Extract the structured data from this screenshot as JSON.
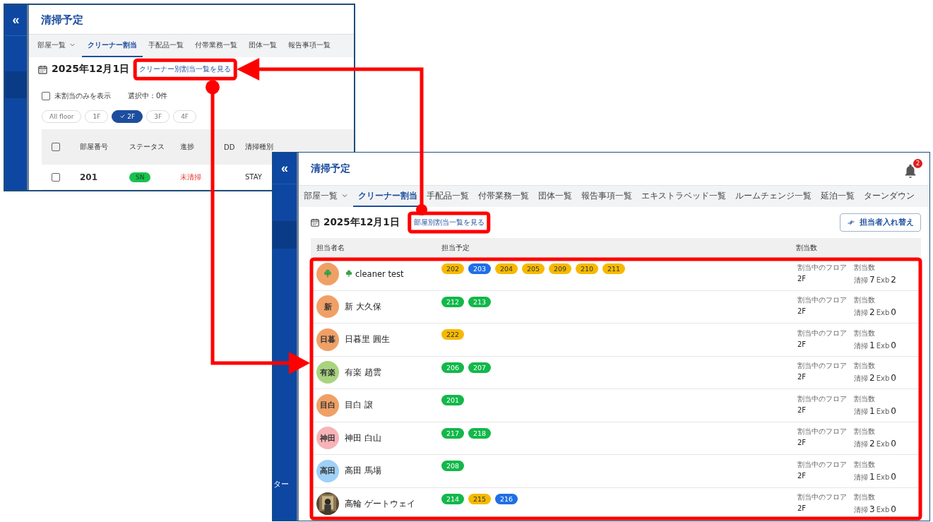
{
  "window_1": {
    "collapse": "«",
    "title": "清掃予定",
    "tabs": [
      {
        "label": "部屋一覧",
        "selected": false,
        "dropdown": true
      },
      {
        "label": "クリーナー割当",
        "selected": true,
        "dropdown": false
      },
      {
        "label": "手配品一覧",
        "selected": false,
        "dropdown": false
      },
      {
        "label": "付帯業務一覧",
        "selected": false,
        "dropdown": false
      },
      {
        "label": "団体一覧",
        "selected": false,
        "dropdown": false
      },
      {
        "label": "報告事項一覧",
        "selected": false,
        "dropdown": false
      }
    ],
    "date": "2025年12月1日",
    "link": "クリーナー別割当一覧を見る",
    "filter": {
      "label": "未割当のみを表示",
      "checked": false
    },
    "selection": "選択中：0件",
    "floors": [
      {
        "label": "All floor",
        "selected": false
      },
      {
        "label": "1F",
        "selected": false
      },
      {
        "label": "2F",
        "selected": true
      },
      {
        "label": "3F",
        "selected": false
      },
      {
        "label": "4F",
        "selected": false
      }
    ],
    "table": {
      "select_all_checked": false,
      "columns": [
        "部屋番号",
        "ステータス",
        "進捗",
        "DD",
        "清掃種別"
      ],
      "rows": [
        {
          "checked": false,
          "room": "201",
          "status": "SN",
          "progress": "未清掃",
          "type": "STAY"
        }
      ]
    }
  },
  "window_2": {
    "collapse": "«",
    "sidebar_label": "ター",
    "title": "清掃予定",
    "notifications": "2",
    "tabs": [
      {
        "label": "部屋一覧",
        "selected": false,
        "dropdown": true
      },
      {
        "label": "クリーナー割当",
        "selected": true,
        "dropdown": false
      },
      {
        "label": "手配品一覧",
        "selected": false,
        "dropdown": false
      },
      {
        "label": "付帯業務一覧",
        "selected": false,
        "dropdown": false
      },
      {
        "label": "団体一覧",
        "selected": false,
        "dropdown": false
      },
      {
        "label": "報告事項一覧",
        "selected": false,
        "dropdown": false
      },
      {
        "label": "エキストラベッド一覧",
        "selected": false,
        "dropdown": false
      },
      {
        "label": "ルームチェンジ一覧",
        "selected": false,
        "dropdown": false
      },
      {
        "label": "延泊一覧",
        "selected": false,
        "dropdown": false
      },
      {
        "label": "ターンダウン",
        "selected": false,
        "dropdown": false
      }
    ],
    "date": "2025年12月1日",
    "link": "部屋別割当一覧を見る",
    "swap_button": "担当者入れ替え",
    "columns": [
      "担当者名",
      "担当予定",
      "割当数"
    ],
    "rows": [
      {
        "avatar": {
          "kind": "icon",
          "color": "#f0a066"
        },
        "name": "cleaner test",
        "rooms": [
          {
            "number": "202",
            "color": "#f6b900"
          },
          {
            "number": "203",
            "color": "#1f6fe6"
          },
          {
            "number": "204",
            "color": "#f6b900"
          },
          {
            "number": "205",
            "color": "#f6b900"
          },
          {
            "number": "209",
            "color": "#f6b900"
          },
          {
            "number": "210",
            "color": "#f6b900"
          },
          {
            "number": "211",
            "color": "#f6b900"
          }
        ],
        "floor_label": "割当中のフロア",
        "floor": "2F",
        "count_label": "割当数",
        "clean_label": "清掃",
        "clean_count": "7",
        "exb_label": "Exb",
        "exb_count": "2"
      },
      {
        "avatar": {
          "kind": "initials",
          "text": "新",
          "color": "#f0a066"
        },
        "name": "新 大久保",
        "rooms": [
          {
            "number": "212",
            "color": "#12b84a"
          },
          {
            "number": "213",
            "color": "#12b84a"
          }
        ],
        "floor_label": "割当中のフロア",
        "floor": "2F",
        "count_label": "割当数",
        "clean_label": "清掃",
        "clean_count": "2",
        "exb_label": "Exb",
        "exb_count": "0"
      },
      {
        "avatar": {
          "kind": "initials",
          "text": "日暮",
          "color": "#f0a066"
        },
        "name": "日暮里 圓生",
        "rooms": [
          {
            "number": "222",
            "color": "#f6b900"
          }
        ],
        "floor_label": "割当中のフロア",
        "floor": "2F",
        "count_label": "割当数",
        "clean_label": "清掃",
        "clean_count": "1",
        "exb_label": "Exb",
        "exb_count": "0"
      },
      {
        "avatar": {
          "kind": "initials",
          "text": "有楽",
          "color": "#a8d47f"
        },
        "name": "有楽 趙雲",
        "rooms": [
          {
            "number": "206",
            "color": "#12b84a"
          },
          {
            "number": "207",
            "color": "#12b84a"
          }
        ],
        "floor_label": "割当中のフロア",
        "floor": "2F",
        "count_label": "割当数",
        "clean_label": "清掃",
        "clean_count": "2",
        "exb_label": "Exb",
        "exb_count": "0"
      },
      {
        "avatar": {
          "kind": "initials",
          "text": "目白",
          "color": "#f0a066"
        },
        "name": "目白 譲",
        "rooms": [
          {
            "number": "201",
            "color": "#12b84a"
          }
        ],
        "floor_label": "割当中のフロア",
        "floor": "2F",
        "count_label": "割当数",
        "clean_label": "清掃",
        "clean_count": "1",
        "exb_label": "Exb",
        "exb_count": "0"
      },
      {
        "avatar": {
          "kind": "initials",
          "text": "神田",
          "color": "#f7b3b8"
        },
        "name": "神田 白山",
        "rooms": [
          {
            "number": "217",
            "color": "#12b84a"
          },
          {
            "number": "218",
            "color": "#12b84a"
          }
        ],
        "floor_label": "割当中のフロア",
        "floor": "2F",
        "count_label": "割当数",
        "clean_label": "清掃",
        "clean_count": "2",
        "exb_label": "Exb",
        "exb_count": "0"
      },
      {
        "avatar": {
          "kind": "initials",
          "text": "高田",
          "color": "#9fd0f7"
        },
        "name": "高田 馬場",
        "rooms": [
          {
            "number": "208",
            "color": "#12b84a"
          }
        ],
        "floor_label": "割当中のフロア",
        "floor": "2F",
        "count_label": "割当数",
        "clean_label": "清掃",
        "clean_count": "1",
        "exb_label": "Exb",
        "exb_count": "0"
      },
      {
        "name": "高輪 ゲートウェイ",
        "rooms": [
          {
            "number": "214",
            "color": "#12b84a"
          },
          {
            "number": "215",
            "color": "#f6b900"
          },
          {
            "number": "216",
            "color": "#1f6fe6"
          }
        ],
        "floor_label": "割当中のフロア",
        "floor": "2F",
        "count_label": "割当数",
        "clean_label": "清掃",
        "clean_count": "3",
        "exb_label": "Exb",
        "exb_count": "0"
      }
    ]
  }
}
